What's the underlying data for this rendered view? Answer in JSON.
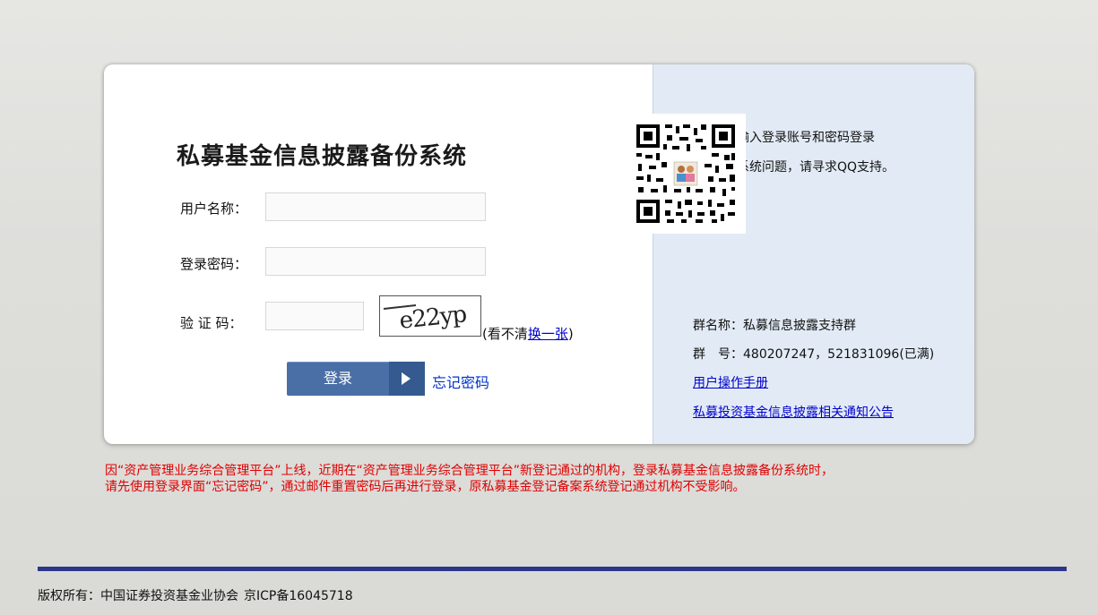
{
  "login": {
    "title": "私募基金信息披露备份系统",
    "username_label": "用户名称：",
    "password_label": "登录密码：",
    "captcha_label": "验 证 码：",
    "username_value": "",
    "password_value": "",
    "captcha_value": "",
    "captcha_text": "e22yp",
    "captcha_hint_prefix": "(看不清",
    "captcha_refresh_link": "换一张",
    "captcha_hint_suffix": ")",
    "login_button": "登录",
    "forgot_password_link": "忘记密码"
  },
  "support": {
    "line1": "请从左侧输入登录账号和密码登录",
    "line2": "如果遇到系统问题，请寻求QQ支持。",
    "group_name": "群名称：私募信息披露支持群",
    "group_number": "群　号：480207247，521831096(已满)",
    "manual_link": "用户操作手册",
    "notice_link": "私募投资基金信息披露相关通知公告"
  },
  "notice": {
    "line1": "因“资产管理业务综合管理平台”上线，近期在“资产管理业务综合管理平台”新登记通过的机构，登录私募基金信息披露备份系统时，",
    "line2": "请先使用登录界面“忘记密码”，通过邮件重置密码后再进行登录，原私募基金登记备案系统登记通过机构不受影响。"
  },
  "footer": {
    "copyright": "版权所有：中国证券投资基金业协会",
    "icp": "京ICP备16045718"
  },
  "colors": {
    "button_bg": "#4a6fa6",
    "notice_red": "#e00000",
    "link_blue": "#0000cc",
    "footer_bar": "#2b3689",
    "right_panel_bg": "#e2ebf5"
  },
  "icons": {
    "qr_code": "qq-group-qr-code-icon",
    "arrow": "play-arrow-icon"
  }
}
